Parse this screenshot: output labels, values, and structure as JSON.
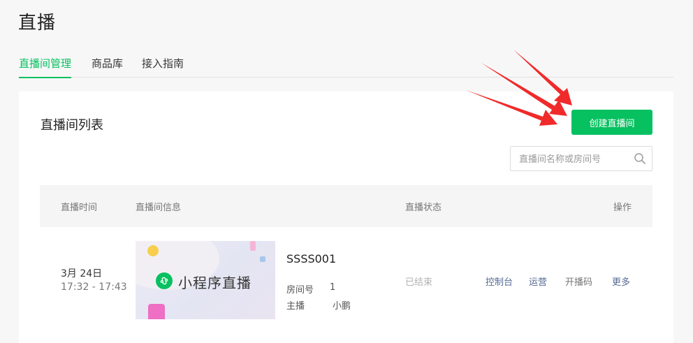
{
  "page": {
    "title": "直播"
  },
  "tabs": [
    {
      "label": "直播间管理",
      "active": true
    },
    {
      "label": "商品库",
      "active": false
    },
    {
      "label": "接入指南",
      "active": false
    }
  ],
  "card": {
    "title": "直播间列表",
    "create_button": "创建直播间",
    "search_placeholder": "直播间名称或房间号"
  },
  "table": {
    "headers": [
      "直播时间",
      "直播间信息",
      "直播状态",
      "操作"
    ],
    "rows": [
      {
        "date": "3月 24日",
        "time": "17:32 - 17:43",
        "cover_text": "小程序直播",
        "room_name": "SSSS001",
        "room_no_label": "房间号",
        "room_no": "1",
        "anchor_label": "主播",
        "anchor": "小鹏",
        "status": "已结束",
        "actions": [
          "控制台",
          "运营",
          "开播码",
          "更多"
        ]
      }
    ]
  },
  "colors": {
    "accent": "#07c160",
    "link": "#576b95",
    "annotation": "#f02a2a"
  }
}
